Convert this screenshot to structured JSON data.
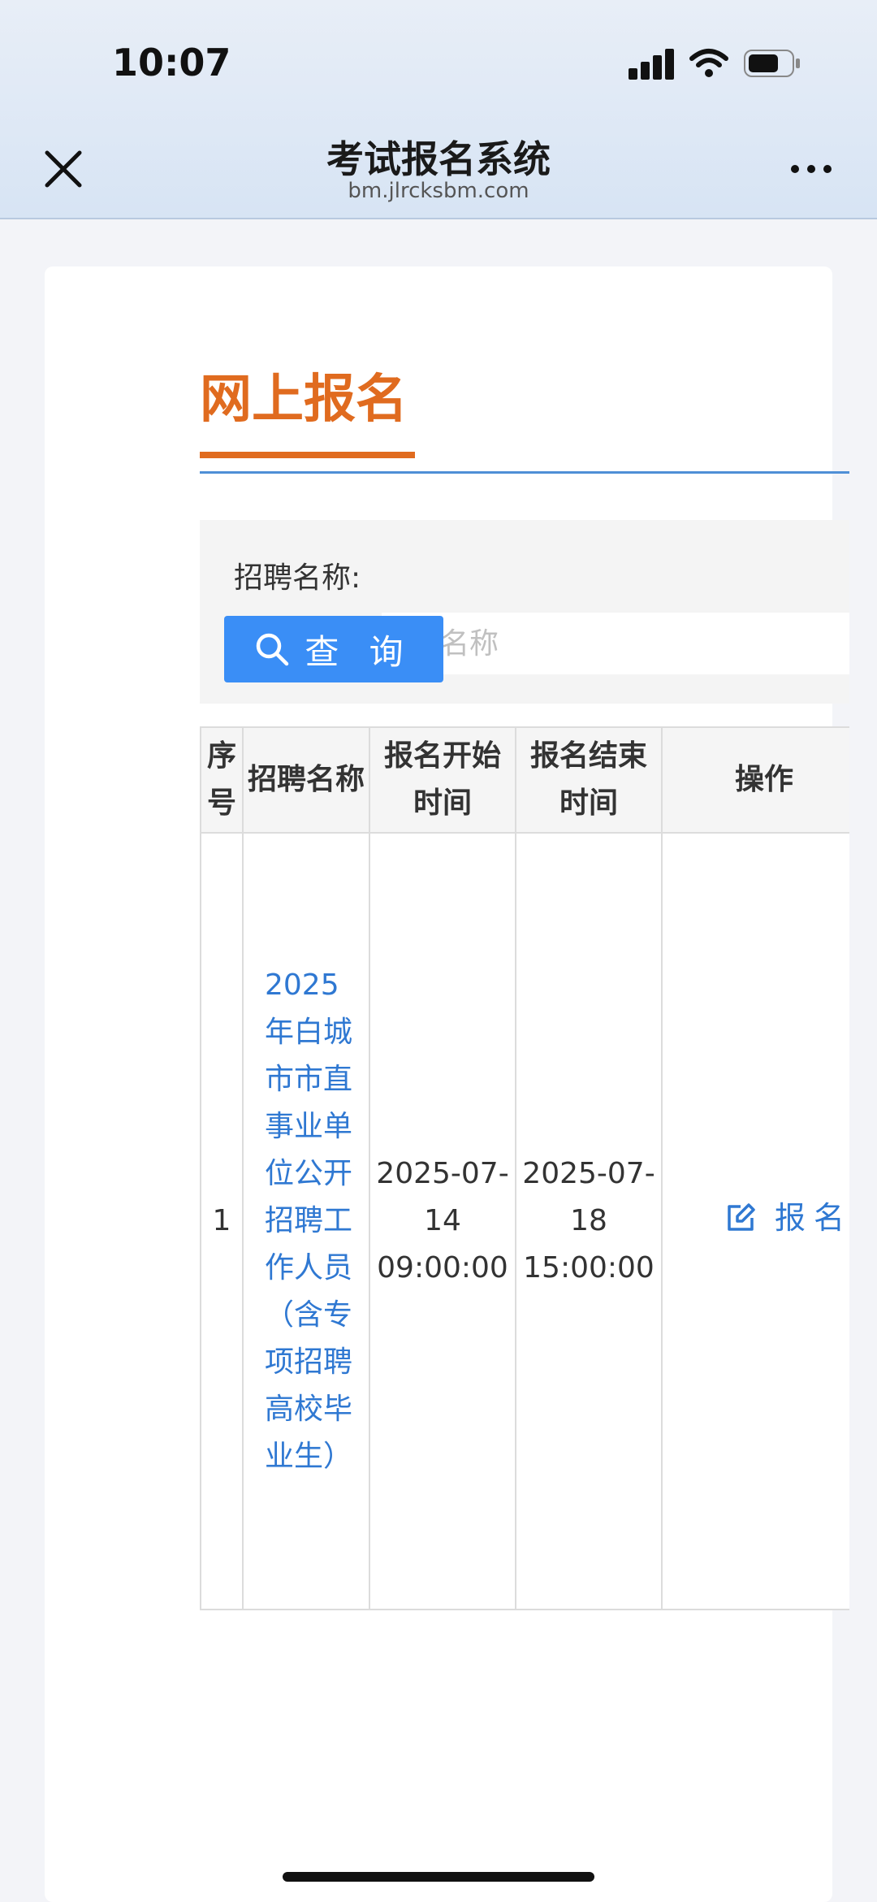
{
  "status_bar": {
    "time": "10:07"
  },
  "nav": {
    "title": "考试报名系统",
    "subtitle": "bm.jlrcksbm.com"
  },
  "section": {
    "title": "网上报名"
  },
  "search": {
    "label": "招聘名称:",
    "placeholder": "名称",
    "value": "",
    "button_label": "查 询"
  },
  "table": {
    "headers": [
      "序号",
      "招聘名称",
      "报名开始时间",
      "报名结束时间",
      "操作"
    ],
    "rows": [
      {
        "index": "1",
        "name": "2025年白城市市直事业单位公开招聘工作人员（含专项招聘高校毕业生）",
        "start": "2025-07-14 09:00:00",
        "end": "2025-07-18 15:00:00",
        "action": "报名"
      }
    ]
  },
  "colors": {
    "accent": "#e06b1f",
    "primary": "#3a8ef6",
    "link": "#2f78d2"
  },
  "icons": [
    "close-icon",
    "more-icon",
    "search-icon",
    "edit-icon",
    "signal-icon",
    "wifi-icon",
    "battery-icon"
  ]
}
